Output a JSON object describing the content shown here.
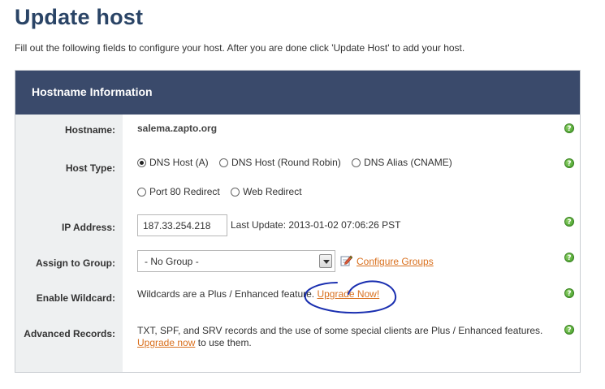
{
  "page": {
    "title": "Update host",
    "intro": "Fill out the following fields to configure your host. After you are done click 'Update Host' to add your host."
  },
  "panel": {
    "header": "Hostname Information"
  },
  "fields": {
    "hostname": {
      "label": "Hostname:",
      "value": "salema.zapto.org"
    },
    "host_type": {
      "label": "Host Type:",
      "options": [
        "DNS Host (A)",
        "DNS Host (Round Robin)",
        "DNS Alias (CNAME)",
        "Port 80 Redirect",
        "Web Redirect"
      ],
      "selected": "DNS Host (A)"
    },
    "ip_address": {
      "label": "IP Address:",
      "value": "187.33.254.218",
      "last_update": "Last Update: 2013-01-02 07:06:26 PST"
    },
    "group": {
      "label": "Assign to Group:",
      "selected": "- No Group -",
      "configure_link": "Configure Groups"
    },
    "wildcard": {
      "label": "Enable Wildcard:",
      "text": "Wildcards are a Plus / Enhanced feature.",
      "link": "Upgrade Now!"
    },
    "advanced": {
      "label": "Advanced Records:",
      "text": "TXT, SPF, and SRV records and the use of some special clients are Plus / Enhanced features.",
      "link": "Upgrade now",
      "suffix": "to use them."
    }
  },
  "help_icon_glyph": "?",
  "colors": {
    "title": "#2a4466",
    "header_bg": "#3a4a6b",
    "label_bg": "#eef0f1",
    "link": "#d9701e",
    "help": "#3f9a24",
    "annotation": "#1a2fb0"
  }
}
